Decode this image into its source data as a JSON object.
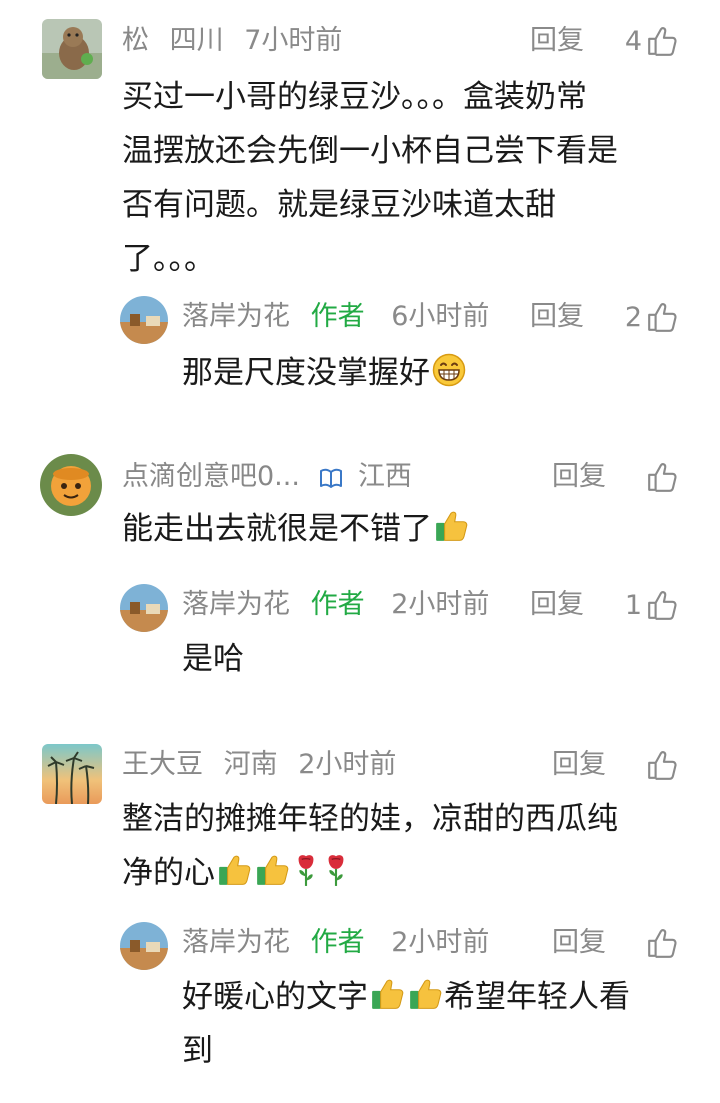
{
  "comments": [
    {
      "user": "松",
      "location": "四川",
      "time": "7小时前",
      "reply_label": "回复",
      "likes": "4",
      "text_lines": [
        "买过一小哥的绿豆沙。。。盒装奶常",
        "温摆放还会先倒一小杯自己尝下看是",
        "否有问题。就是绿豆沙味道太甜",
        "了。。。"
      ],
      "reply": {
        "user": "落岸为花",
        "author_tag": "作者",
        "time": "6小时前",
        "reply_label": "回复",
        "likes": "2",
        "text": "那是尺度没掌握好",
        "emoji": "grinning-face"
      }
    },
    {
      "user": "点滴创意吧0...",
      "location": "江西",
      "badge_icon": "vip-book-icon",
      "reply_label": "回复",
      "likes": "",
      "text": "能走出去就很是不错了",
      "emoji": "thumbs-up",
      "reply": {
        "user": "落岸为花",
        "author_tag": "作者",
        "time": "2小时前",
        "reply_label": "回复",
        "likes": "1",
        "text": "是哈"
      }
    },
    {
      "user": "王大豆",
      "location": "河南",
      "time": "2小时前",
      "reply_label": "回复",
      "likes": "",
      "text_lines": [
        "整洁的摊摊年轻的娃，凉甜的西瓜纯",
        "净的心"
      ],
      "emojis": [
        "thumbs-up",
        "thumbs-up",
        "rose",
        "rose"
      ],
      "reply": {
        "user": "落岸为花",
        "author_tag": "作者",
        "time": "2小时前",
        "reply_label": "回复",
        "likes": "",
        "text_line1_a": "好暖心的文字",
        "text_line1_b": "希望年轻人看",
        "text_line2": "到",
        "emojis": [
          "thumbs-up",
          "thumbs-up"
        ]
      }
    }
  ],
  "colors": {
    "meta": "#8a8a8a",
    "author": "#22aa44",
    "text": "#1a1a1a"
  }
}
